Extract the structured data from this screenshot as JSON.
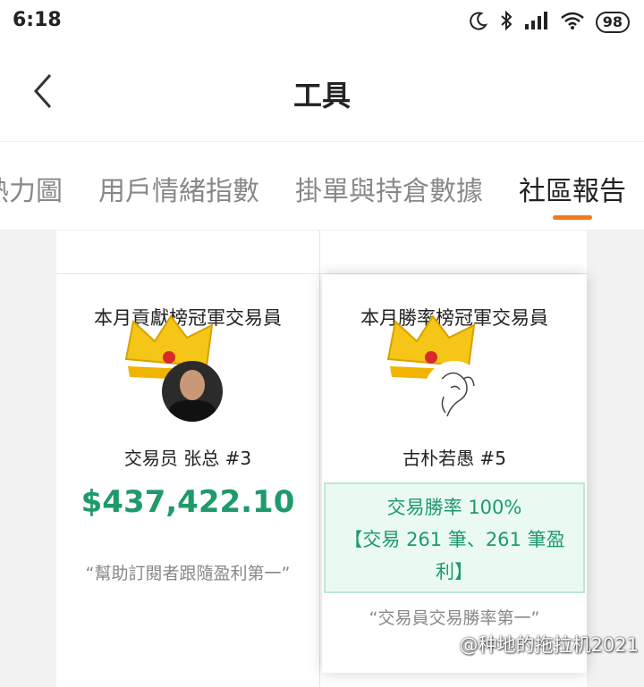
{
  "status_bar": {
    "time": "6:18",
    "battery": "98",
    "icons": [
      "moon-icon",
      "bluetooth-icon",
      "signal-icon",
      "wifi-icon",
      "battery-icon"
    ]
  },
  "header": {
    "title": "工具",
    "back_icon": "chevron-left-icon"
  },
  "tabs": [
    {
      "label": "熱力圖",
      "active": false
    },
    {
      "label": "用戶情緒指數",
      "active": false
    },
    {
      "label": "掛單與持倉數據",
      "active": false
    },
    {
      "label": "社區報告",
      "active": true
    }
  ],
  "accent_color": "#f07a1e",
  "profit_color": "#1f9a6a",
  "cards": [
    {
      "title": "本月貢獻榜冠軍交易員",
      "name_line": "交易员 张总 #3",
      "value": "$437,422.10",
      "quote": "“幫助訂閱者跟隨盈利第一”"
    },
    {
      "title": "本月勝率榜冠軍交易員",
      "name_line": "古朴若愚 #5",
      "winrate_line1": "交易勝率 100%",
      "winrate_line2": "【交易 261 筆、261 筆盈",
      "winrate_line3": "利】",
      "quote": "“交易員交易勝率第一”"
    }
  ],
  "watermark": "@种地的拖拉机2021"
}
